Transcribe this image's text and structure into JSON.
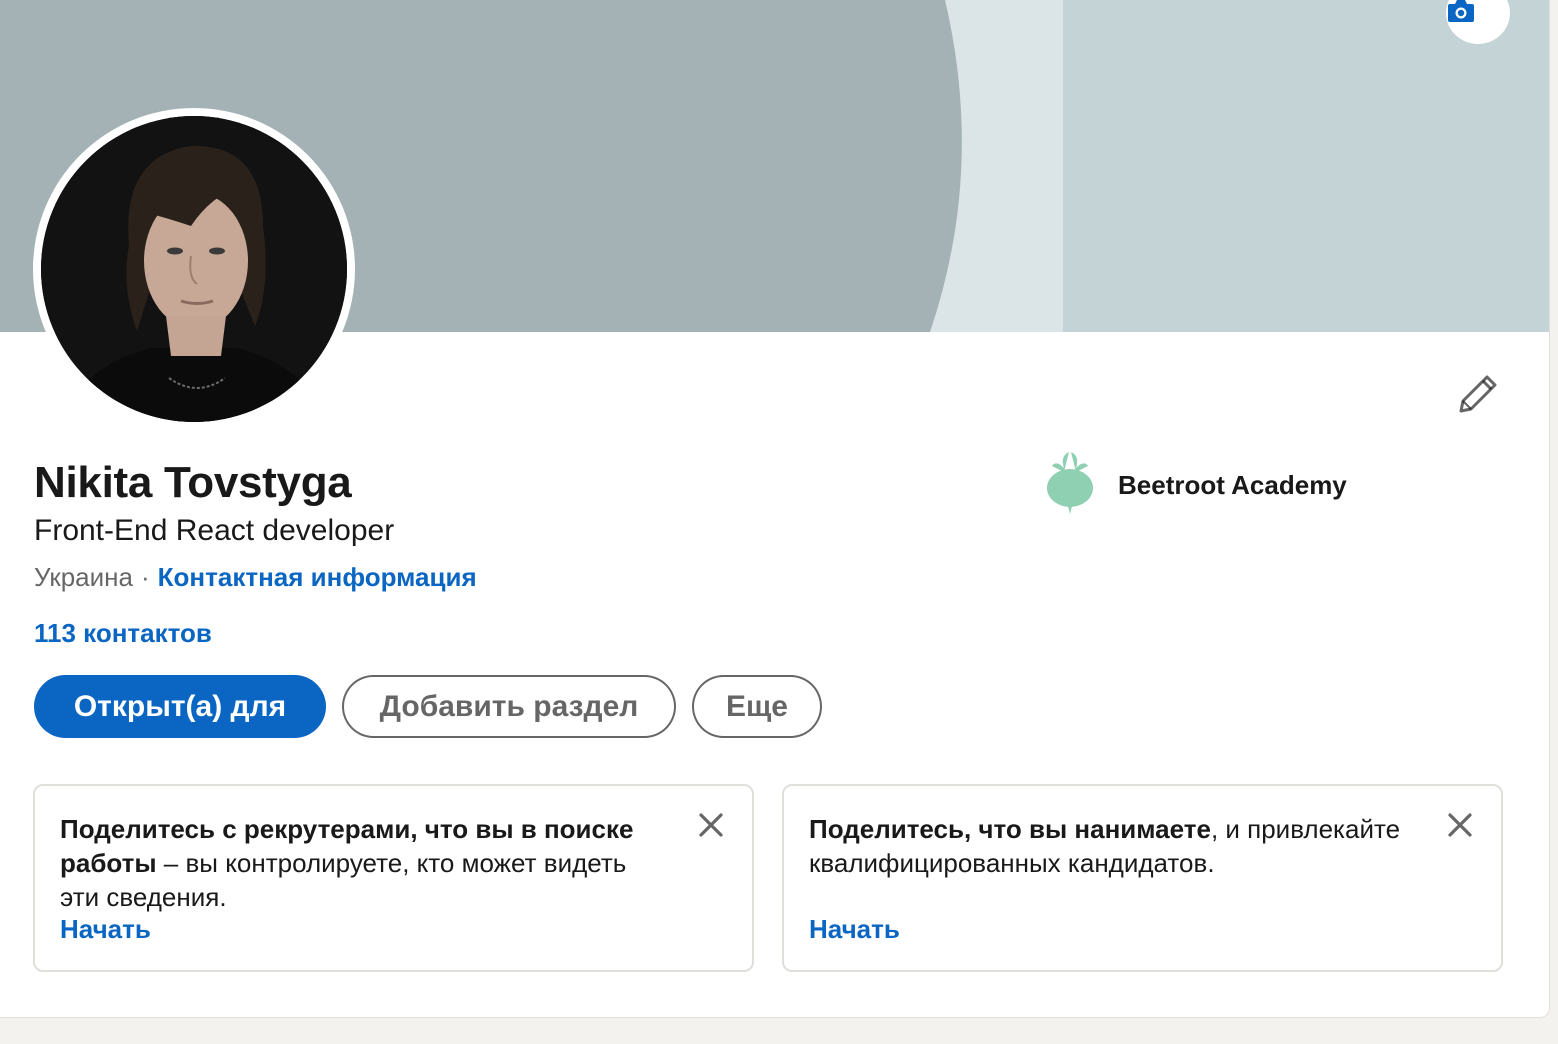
{
  "profile": {
    "name": "Nikita Tovstyga",
    "headline": "Front-End React developer",
    "location": "Украина",
    "separator": "·",
    "contact_info_label": "Контактная информация",
    "connections_label": "113 контактов"
  },
  "organization": {
    "name": "Beetroot Academy",
    "logo_icon": "beetroot-logo-icon"
  },
  "actions": {
    "open_to_label": "Открыт(а) для",
    "add_section_label": "Добавить раздел",
    "more_label": "Еще"
  },
  "prompts": [
    {
      "bold_text": "Поделитесь с рекрутерами, что вы в поиске работы",
      "rest_text": " – вы контролируете, кто может видеть эти сведения.",
      "cta_label": "Начать"
    },
    {
      "bold_text": "Поделитесь, что вы нанимаете",
      "rest_text": ", и привлекайте квалифицированных кандидатов.",
      "cta_label": "Начать"
    }
  ],
  "icons": {
    "camera": "camera-icon",
    "edit": "pencil-icon",
    "close": "close-icon"
  },
  "colors": {
    "accent": "#0a66c2",
    "banner_dark": "#a4b2b6",
    "banner_light": "#dbe4e6",
    "banner_right": "#c3d3d6",
    "logo_green": "#8fcfb2"
  }
}
